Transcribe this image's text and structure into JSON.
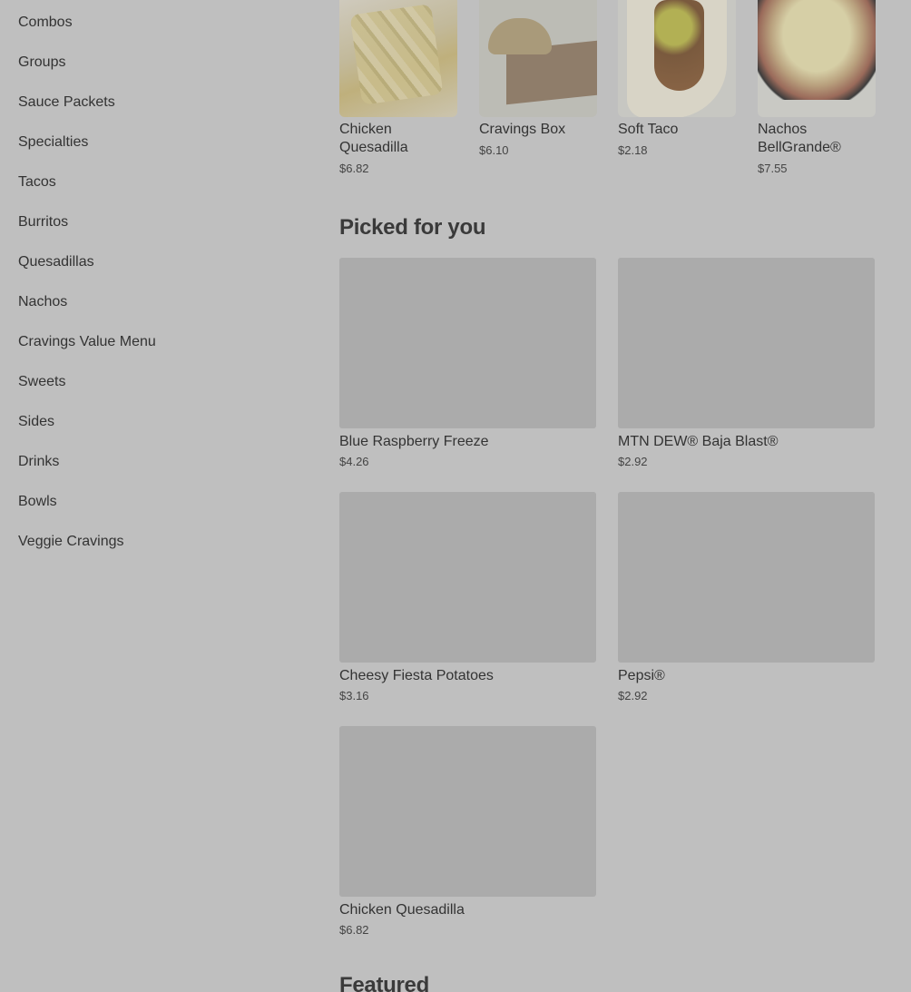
{
  "categories": [
    "Combos",
    "Groups",
    "Sauce Packets",
    "Specialties",
    "Tacos",
    "Burritos",
    "Quesadillas",
    "Nachos",
    "Cravings Value Menu",
    "Sweets",
    "Sides",
    "Drinks",
    "Bowls",
    "Veggie Cravings"
  ],
  "top_items": [
    {
      "name": "Chicken Quesadilla",
      "price": "$6.82",
      "image": "chicken-quesadilla-image"
    },
    {
      "name": "Cravings Box",
      "price": "$6.10",
      "image": "cravings-box-image"
    },
    {
      "name": "Soft Taco",
      "price": "$2.18",
      "image": "soft-taco-image"
    },
    {
      "name": "Nachos BellGrande®",
      "price": "$7.55",
      "image": "nachos-bellgrande-image"
    }
  ],
  "picked": {
    "title": "Picked for you",
    "items": [
      {
        "name": "Blue Raspberry Freeze",
        "price": "$4.26"
      },
      {
        "name": "MTN DEW® Baja Blast®",
        "price": "$2.92"
      },
      {
        "name": "Cheesy Fiesta Potatoes",
        "price": "$3.16"
      },
      {
        "name": "Pepsi®",
        "price": "$2.92"
      },
      {
        "name": "Chicken Quesadilla",
        "price": "$6.82"
      }
    ]
  },
  "featured": {
    "title": "Featured"
  }
}
